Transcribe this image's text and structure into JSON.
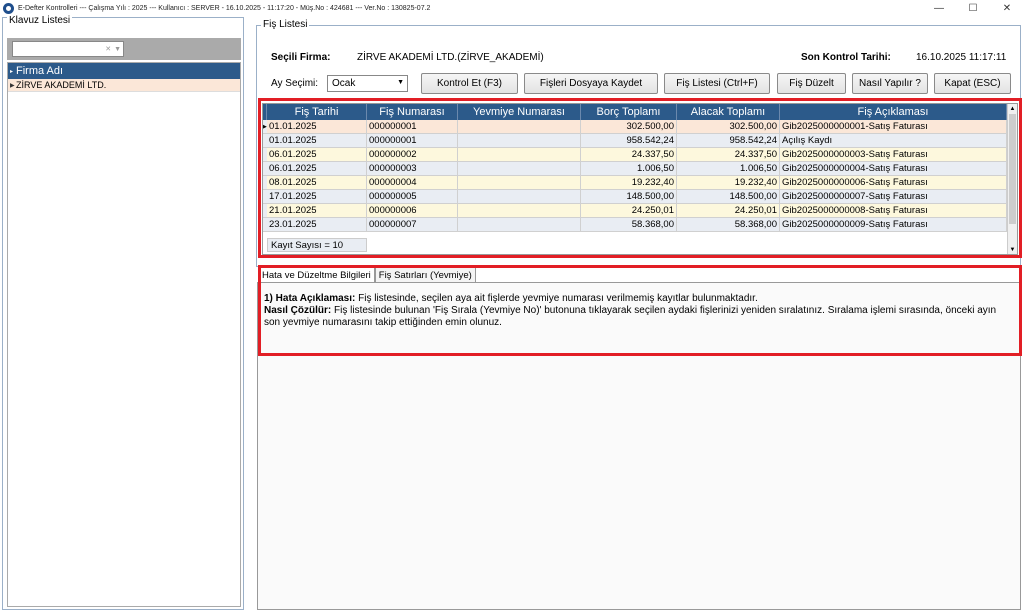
{
  "window": {
    "title": "E-Defter Kontrolleri  ---  Çalışma Yılı : 2025  ---  Kullanıcı : SERVER - 16.10.2025 - 11:17:20 - Müş.No : 424681  ---  Ver.No : 130825-07.2",
    "minimize": "—",
    "maximize": "☐",
    "close": "✕"
  },
  "left": {
    "title": "Klavuz Listesi",
    "list_header": "Firma Adı",
    "rows": [
      "ZİRVE AKADEMİ LTD."
    ]
  },
  "right": {
    "title": "Fiş Listesi",
    "firm_label": "Seçili Firma:",
    "firm_value": "ZİRVE AKADEMİ LTD.(ZİRVE_AKADEMİ)",
    "last_check_label": "Son Kontrol Tarihi:",
    "last_check_value": "16.10.2025 11:17:11",
    "month_label": "Ay Seçimi:",
    "month_value": "Ocak",
    "buttons": {
      "kontrol": "Kontrol Et (F3)",
      "kaydet": "Fişleri Dosyaya Kaydet",
      "liste": "Fiş Listesi (Ctrl+F)",
      "duzelt": "Fiş Düzelt",
      "nasil": "Nasıl Yapılır ?",
      "kapat": "Kapat (ESC)"
    }
  },
  "grid": {
    "columns": [
      "Fiş Tarihi",
      "Fiş Numarası",
      "Yevmiye Numarası",
      "Borç Toplamı",
      "Alacak Toplamı",
      "Fiş Açıklaması"
    ],
    "rows": [
      [
        "01.01.2025",
        "000000001",
        "",
        "302.500,00",
        "302.500,00",
        "Gib2025000000001-Satış Faturası"
      ],
      [
        "01.01.2025",
        "000000001",
        "",
        "958.542,24",
        "958.542,24",
        "Açılış Kaydı"
      ],
      [
        "06.01.2025",
        "000000002",
        "",
        "24.337,50",
        "24.337,50",
        "Gib2025000000003-Satış Faturası"
      ],
      [
        "06.01.2025",
        "000000003",
        "",
        "1.006,50",
        "1.006,50",
        "Gib2025000000004-Satış Faturası"
      ],
      [
        "08.01.2025",
        "000000004",
        "",
        "19.232,40",
        "19.232,40",
        "Gib2025000000006-Satış Faturası"
      ],
      [
        "17.01.2025",
        "000000005",
        "",
        "148.500,00",
        "148.500,00",
        "Gib2025000000007-Satış Faturası"
      ],
      [
        "21.01.2025",
        "000000006",
        "",
        "24.250,01",
        "24.250,01",
        "Gib2025000000008-Satış Faturası"
      ],
      [
        "23.01.2025",
        "000000007",
        "",
        "58.368,00",
        "58.368,00",
        "Gib2025000000009-Satış Faturası"
      ]
    ],
    "footer": "Kayıt Sayısı = 10"
  },
  "tabs": {
    "errors": "Hata ve Düzeltme Bilgileri",
    "lines": "Fiş Satırları (Yevmiye)"
  },
  "info": {
    "err_title": "1) Hata Açıklaması:",
    "err_text": " Fiş listesinde, seçilen aya ait fişlerde yevmiye numarası verilmemiş kayıtlar bulunmaktadır.",
    "fix_title": "Nasıl Çözülür:",
    "fix_text": " Fiş listesinde bulunan 'Fiş Sırala (Yevmiye No)' butonuna tıklayarak seçilen aydaki fişlerinizi yeniden sıralatınız. Sıralama işlemi sırasında, önceki ayın son yevmiye numarasını takip ettiğinden emin olunuz."
  },
  "colors": {
    "header": "#2c5a8a",
    "highlight": "#e21e25",
    "selected_row": "#fbe7d8"
  }
}
